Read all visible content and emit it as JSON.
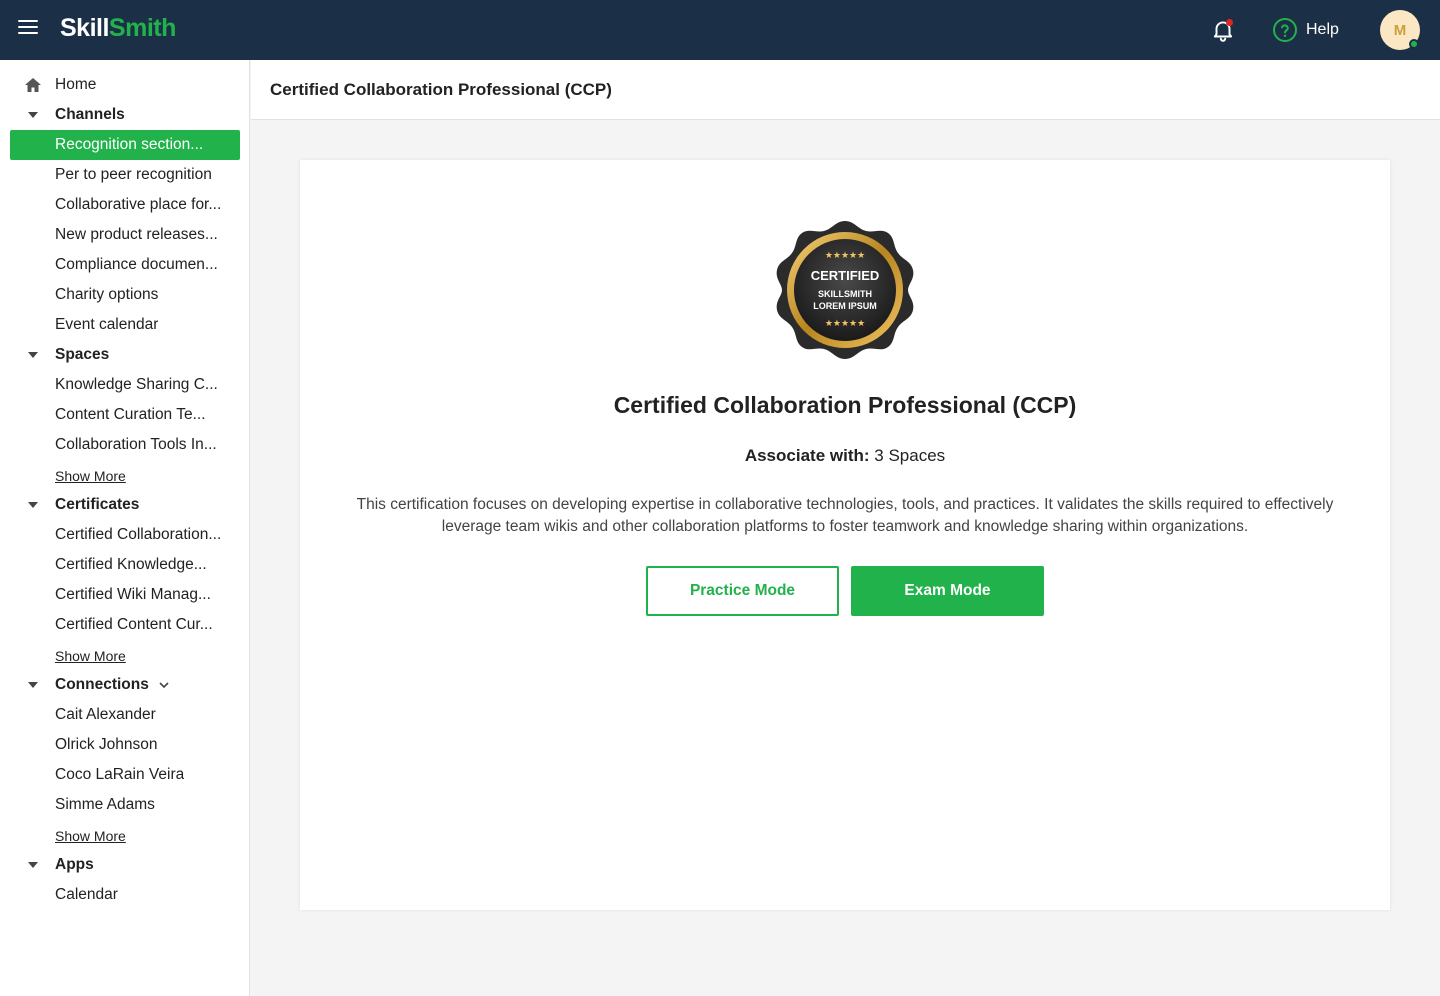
{
  "app": {
    "logo_part1": "Skill",
    "logo_part2": "Smith",
    "brand_color": "#22b24c",
    "topbar_color": "#1b3047"
  },
  "topbar": {
    "menu_icon": "hamburger-icon",
    "notification_icon": "bell-icon",
    "help_icon": "question-circle-icon",
    "help_label": "Help",
    "avatar_initial": "M"
  },
  "sidebar": {
    "home": {
      "label": "Home",
      "icon": "home-icon"
    },
    "channels": {
      "label": "Channels",
      "items": [
        "Recognition section...",
        "Per to peer recognition",
        "Collaborative place for...",
        "New product releases...",
        "Compliance documen...",
        "Charity options",
        "Event calendar"
      ],
      "active_index": 0
    },
    "spaces": {
      "label": "Spaces",
      "items": [
        "Knowledge Sharing C...",
        "Content Curation Te...",
        "Collaboration Tools In..."
      ],
      "show_more": "Show More"
    },
    "certificates": {
      "label": "Certificates",
      "items": [
        "Certified Collaboration...",
        "Certified Knowledge...",
        "Certified Wiki Manag...",
        "Certified Content Cur..."
      ],
      "show_more": "Show More"
    },
    "connections": {
      "label": "Connections",
      "items": [
        "Cait Alexander",
        "Olrick Johnson",
        "Coco LaRain Veira",
        "Simme Adams"
      ],
      "show_more": "Show More"
    },
    "apps": {
      "label": "Apps",
      "items": [
        "Calendar"
      ]
    }
  },
  "page": {
    "header_title": "Certified Collaboration Professional (CCP)",
    "badge": {
      "line1": "CERTIFIED",
      "line2": "SKILLSMITH",
      "line3": "LOREM IPSUM",
      "stars": "★★★★★"
    },
    "cert_title": "Certified Collaboration Professional (CCP)",
    "associate_label": "Associate with:",
    "associate_value": "3 Spaces",
    "description": "This certification focuses on developing expertise in collaborative technologies, tools, and practices. It validates the skills required to effectively leverage team wikis and other collaboration platforms to foster teamwork and knowledge sharing within organizations.",
    "practice_button": "Practice Mode",
    "exam_button": "Exam Mode"
  }
}
